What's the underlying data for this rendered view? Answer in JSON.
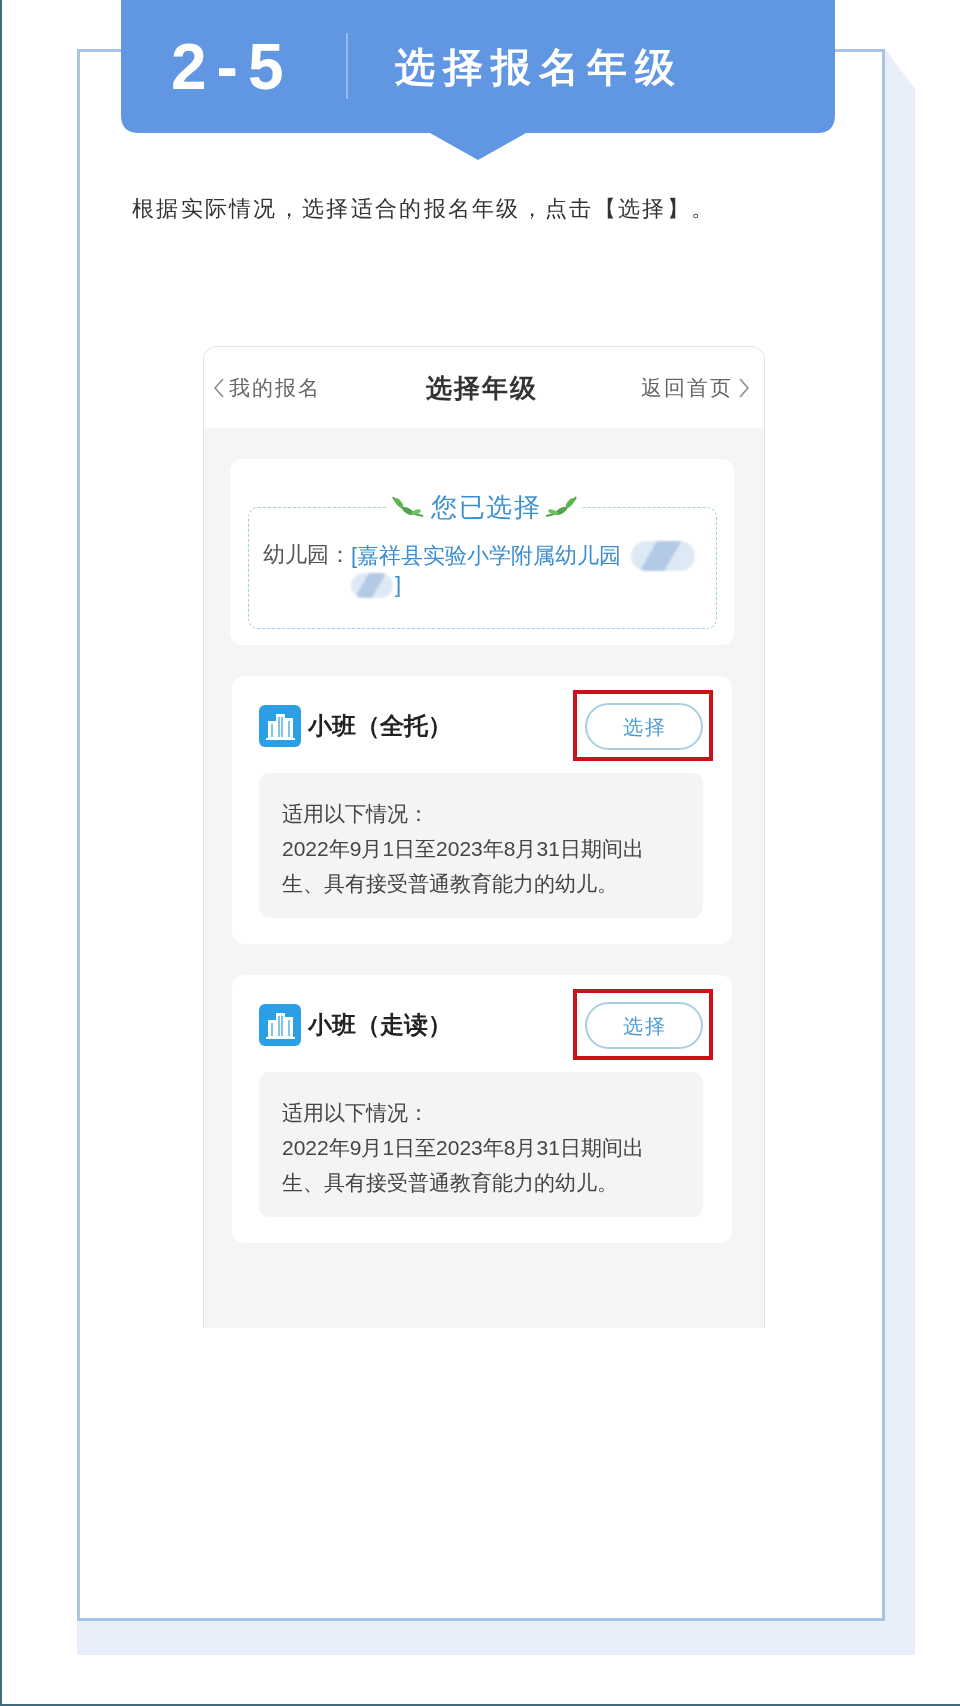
{
  "banner": {
    "step": "2-5",
    "title": "选择报名年级"
  },
  "instruction": "根据实际情况，选择适合的报名年级，点击【选择】。",
  "phone": {
    "nav": {
      "back": "我的报名",
      "title": "选择年级",
      "home": "返回首页"
    },
    "selection": {
      "heading": "您已选择",
      "label": "幼儿园：",
      "value": "[嘉祥县实验小学附属幼儿园",
      "redacted": true,
      "value_end": "]"
    },
    "grades": [
      {
        "name": "小班（全托）",
        "button": "选择",
        "highlighted": true,
        "criteria_heading": "适用以下情况：",
        "criteria": "2022年9月1日至2023年8月31日期间出生、具有接受普通教育能力的幼儿。"
      },
      {
        "name": "小班（走读）",
        "button": "选择",
        "highlighted": true,
        "criteria_heading": "适用以下情况：",
        "criteria": "2022年9月1日至2023年8月31日期间出生、具有接受普通教育能力的幼儿。"
      }
    ]
  }
}
